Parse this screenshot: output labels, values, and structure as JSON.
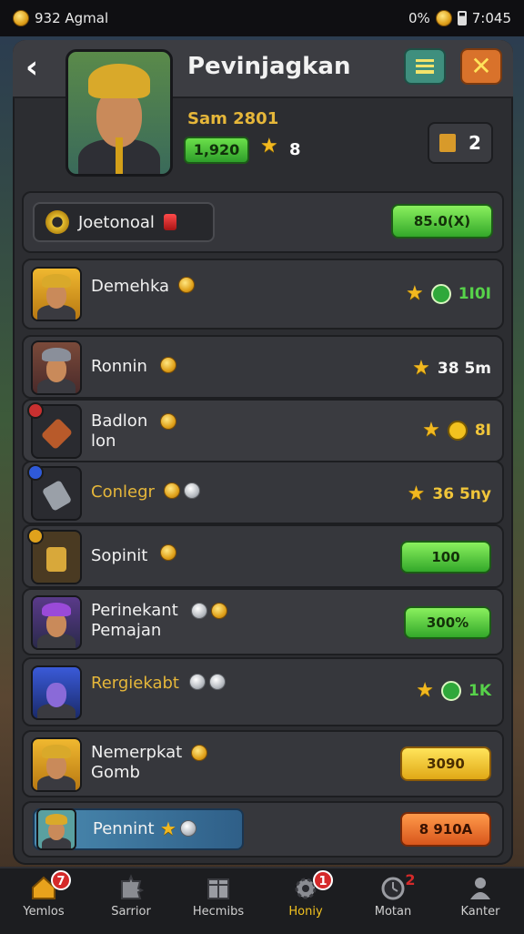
{
  "status_bar": {
    "coins": "932 Agmal",
    "percent": "0%",
    "time": "7:045"
  },
  "header": {
    "title": "Pevinjagkan"
  },
  "profile": {
    "name": "Sam 2801",
    "badge_value": "1,920",
    "level": "8",
    "mail_count": "2"
  },
  "featured": {
    "label": "Joetonoal",
    "button": "85.0(X)"
  },
  "rows": [
    {
      "name_line1": "Demehka",
      "name_line2": "",
      "right_value": "1I0I",
      "right_type": "star-green"
    },
    {
      "name_line1": "Ronnin",
      "name_line2": "",
      "right_value": "38  5m",
      "right_type": "star-text"
    },
    {
      "name_line1": "Badlon",
      "name_line2": "lon",
      "right_value": "8I",
      "right_type": "star-yellow"
    },
    {
      "name_line1": "Conlegr",
      "name_line2": "",
      "right_value": "36  5ny",
      "right_type": "star-text"
    },
    {
      "name_line1": "Sopinit",
      "name_line2": "",
      "right_value": "100",
      "right_type": "button-green"
    },
    {
      "name_line1": "Perinekant",
      "name_line2": "Pemajan",
      "right_value": "300%",
      "right_type": "button-green"
    },
    {
      "name_line1": "Rergiekabt",
      "name_line2": "",
      "right_value": "1K",
      "right_type": "star-green"
    },
    {
      "name_line1": "Nemerpkat",
      "name_line2": "Gomb",
      "right_value": "3090",
      "right_type": "button-yellow"
    },
    {
      "name_line1": "Pennint",
      "name_line2": "",
      "right_value": "8 910A",
      "right_type": "button-orange"
    }
  ],
  "nav": [
    {
      "label": "Yemlos",
      "badge": "7"
    },
    {
      "label": "Sarrior",
      "badge": ""
    },
    {
      "label": "Hecmibs",
      "badge": ""
    },
    {
      "label": "Honiy",
      "badge": "1"
    },
    {
      "label": "Motan",
      "badge": "2"
    },
    {
      "label": "Kanter",
      "badge": ""
    }
  ],
  "colors": {
    "accent_green": "#57d24a",
    "accent_gold": "#e6b73a",
    "panel": "#2c2d31",
    "nav_active": "#f2c21f"
  }
}
